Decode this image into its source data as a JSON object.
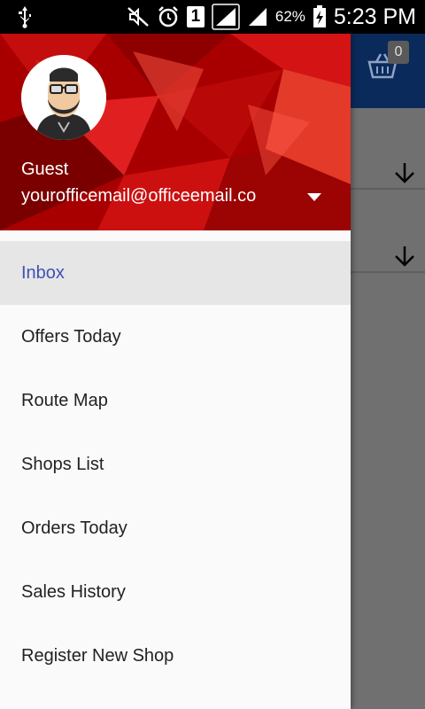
{
  "status_bar": {
    "battery_percent": "62%",
    "time": "5:23 PM",
    "sim_slot": "1",
    "icons": [
      "usb-icon",
      "mute-icon",
      "alarm-icon",
      "sim-1-icon",
      "signal-icon",
      "signal-2-icon",
      "battery-charging-icon"
    ]
  },
  "background_app": {
    "cart_count": "0",
    "toolbar_color": "#0a2a5c"
  },
  "drawer": {
    "header": {
      "name": "Guest",
      "email": "yourofficemail@officeemail.co",
      "colors": {
        "primary": "#b00000",
        "accent": "#e02020"
      }
    },
    "menu": [
      {
        "label": "Inbox",
        "active": true
      },
      {
        "label": "Offers Today"
      },
      {
        "label": "Route Map"
      },
      {
        "label": "Shops List"
      },
      {
        "label": "Orders Today"
      },
      {
        "label": "Sales History"
      },
      {
        "label": "Register New Shop"
      }
    ],
    "active_color": "#3f51b5"
  }
}
